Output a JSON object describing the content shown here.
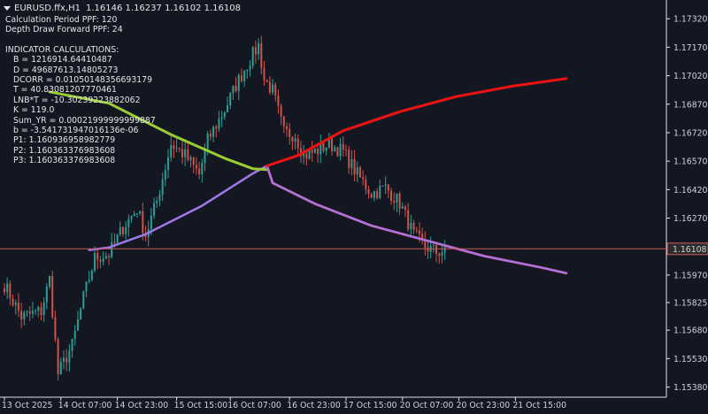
{
  "header": {
    "symbol": "EURUSD.ffx,H1",
    "ohlc": "1.16146 1.16237 1.16102 1.16108"
  },
  "params": [
    "Calculation Period PPF: 120",
    "Depth Draw Forward PPF: 24"
  ],
  "indicator": {
    "heading": "INDICATOR CALCULATIONS:",
    "lines": [
      "B = 1216914.64410487",
      "D = 49687613.14805273",
      "DCORR = 0.01050148356693179",
      "T = 40.83081207770461",
      "LNB*T = -10.30239223882062",
      "K = 119.0",
      "Sum_YR = 0.00021999999999887",
      "b = -3.541731947016136e-06",
      "P1: 1.160936958982779",
      "P2: 1.160363376983608",
      "P3: 1.160363376983608"
    ]
  },
  "colors": {
    "background": "#121722",
    "bull": "#2e9e95",
    "bear": "#d05249",
    "past_regression": "#9acd32",
    "forecast": "#ee1111",
    "channel": "#a178e6",
    "price_line": "#c85a5a",
    "axis_text": "#cfd3da"
  },
  "chart_data": {
    "type": "candlestick",
    "timeframe": "H1",
    "current_price": "1.16108",
    "ylim": [
      1.1535,
      1.174
    ],
    "y_ticks": [
      "1.17320",
      "1.17170",
      "1.17020",
      "1.16870",
      "1.16720",
      "1.16570",
      "1.16420",
      "1.16270",
      "1.16108",
      "1.15970",
      "1.15825",
      "1.15680",
      "1.15530",
      "1.15380"
    ],
    "x_ticks": [
      "13 Oct 2025",
      "14 Oct 07:00",
      "14 Oct 23:00",
      "15 Oct 15:00",
      "16 Oct 07:00",
      "16 Oct 23:00",
      "17 Oct 15:00",
      "20 Oct 07:00",
      "20 Oct 23:00",
      "21 Oct 15:00"
    ],
    "candle_anchors": [
      [
        0,
        1.1592
      ],
      [
        6,
        1.1575
      ],
      [
        13,
        1.1578
      ],
      [
        16,
        1.1595
      ],
      [
        19,
        1.1545
      ],
      [
        24,
        1.156
      ],
      [
        28,
        1.1585
      ],
      [
        32,
        1.1606
      ],
      [
        37,
        1.1608
      ],
      [
        42,
        1.1622
      ],
      [
        47,
        1.1632
      ],
      [
        50,
        1.1618
      ],
      [
        54,
        1.1636
      ],
      [
        59,
        1.1666
      ],
      [
        64,
        1.166
      ],
      [
        69,
        1.165
      ],
      [
        72,
        1.1668
      ],
      [
        78,
        1.1684
      ],
      [
        82,
        1.1697
      ],
      [
        86,
        1.1708
      ],
      [
        90,
        1.1718
      ],
      [
        92,
        1.17
      ],
      [
        95,
        1.1694
      ],
      [
        99,
        1.1672
      ],
      [
        103,
        1.1671
      ],
      [
        106,
        1.166
      ],
      [
        110,
        1.1662
      ],
      [
        115,
        1.1666
      ],
      [
        120,
        1.1662
      ],
      [
        125,
        1.165
      ],
      [
        130,
        1.164
      ],
      [
        135,
        1.1643
      ],
      [
        140,
        1.1635
      ],
      [
        145,
        1.1618
      ],
      [
        149,
        1.1612
      ],
      [
        153,
        1.1609
      ],
      [
        156,
        1.161
      ]
    ],
    "series": [
      {
        "name": "",
        "values": [
          [
            16,
            1.16935
          ],
          [
            37,
            1.16875
          ],
          [
            59,
            1.1671
          ],
          [
            78,
            1.16585
          ],
          [
            88,
            1.1653
          ],
          [
            93,
            1.16525
          ]
        ]
      },
      {
        "name": "",
        "values": [
          [
            30,
            1.16102
          ],
          [
            37,
            1.16115
          ],
          [
            50,
            1.16185
          ],
          [
            70,
            1.16335
          ],
          [
            88,
            1.16505
          ],
          [
            93,
            1.16545
          ],
          [
            104,
            1.166
          ],
          [
            120,
            1.1673
          ],
          [
            140,
            1.1683
          ],
          [
            160,
            1.1691
          ],
          [
            180,
            1.16965
          ],
          [
            199,
            1.17005
          ]
        ]
      },
      {
        "name": "",
        "values": [
          [
            93,
            1.16545
          ],
          [
            95,
            1.16455
          ],
          [
            110,
            1.16345
          ],
          [
            130,
            1.1623
          ],
          [
            150,
            1.1615
          ],
          [
            170,
            1.1607
          ],
          [
            190,
            1.1601
          ],
          [
            199,
            1.1598
          ]
        ]
      }
    ]
  }
}
